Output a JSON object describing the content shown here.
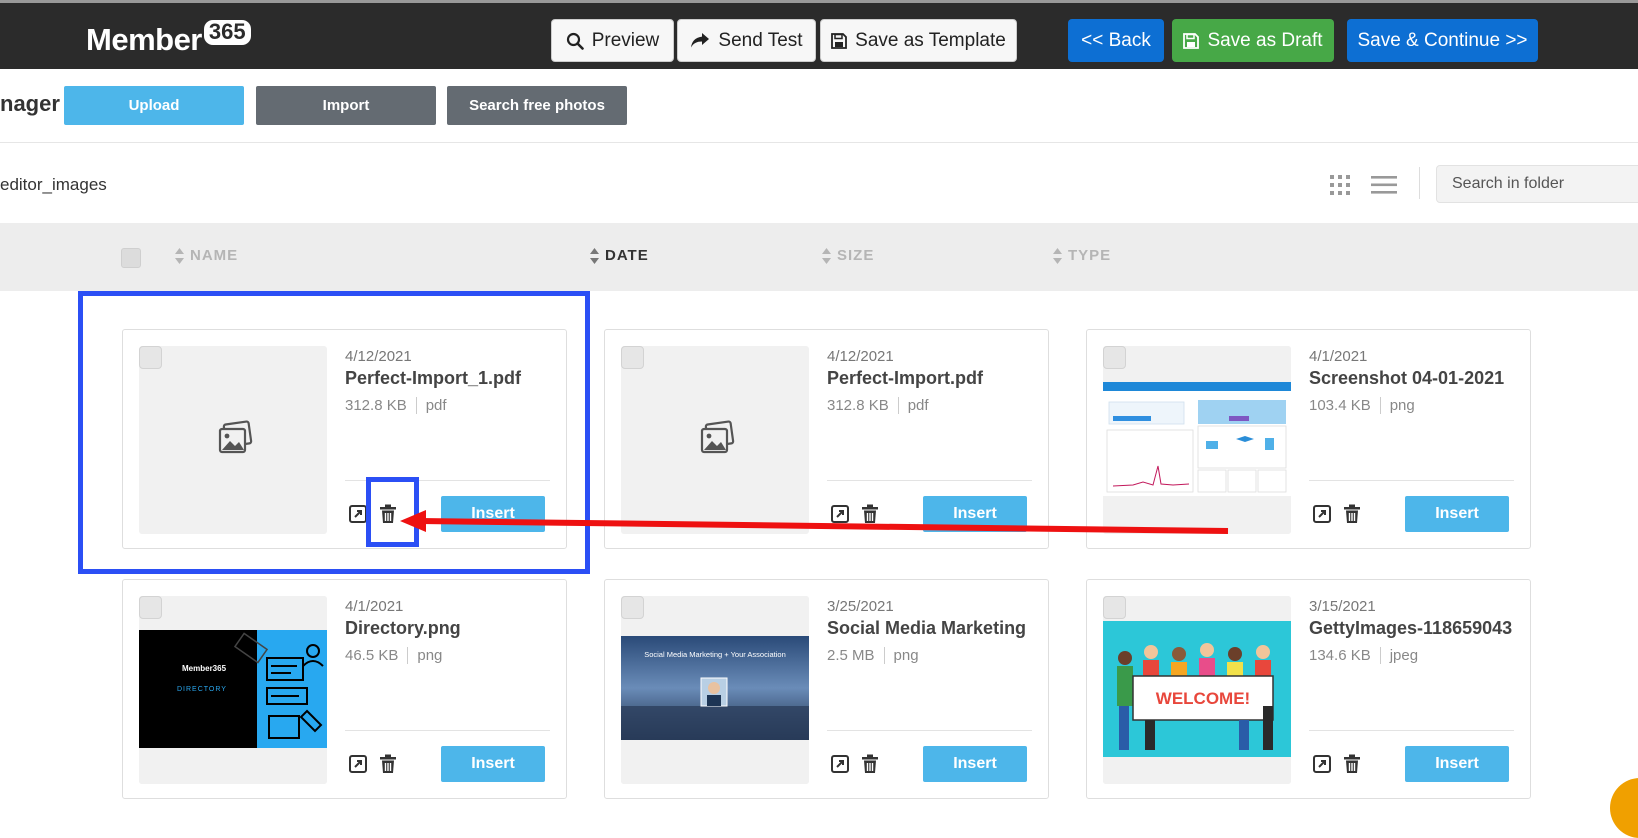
{
  "header": {
    "logo": {
      "word": "Member",
      "badge": "365"
    },
    "buttons": {
      "preview": "Preview",
      "send_test": "Send Test",
      "save_template": "Save as Template",
      "back": "<< Back",
      "save_draft": "Save as Draft",
      "save_continue": "Save & Continue >>"
    }
  },
  "manager": {
    "title": "nager",
    "upload": "Upload",
    "import": "Import",
    "search_photos": "Search free photos"
  },
  "folder": {
    "path": "editor_images",
    "search_placeholder": "Search in folder"
  },
  "columns": {
    "name": "NAME",
    "date": "DATE",
    "size": "SIZE",
    "type": "TYPE"
  },
  "insert_label": "Insert",
  "files": [
    {
      "date": "4/12/2021",
      "name": "Perfect-Import_1.pdf",
      "size": "312.8 KB",
      "type": "pdf",
      "thumb": "placeholder"
    },
    {
      "date": "4/12/2021",
      "name": "Perfect-Import.pdf",
      "size": "312.8 KB",
      "type": "pdf",
      "thumb": "placeholder"
    },
    {
      "date": "4/1/2021",
      "name": "Screenshot 04-01-2021",
      "size": "103.4 KB",
      "type": "png",
      "thumb": "screenshot"
    },
    {
      "date": "4/1/2021",
      "name": "Directory.png",
      "size": "46.5 KB",
      "type": "png",
      "thumb": "directory"
    },
    {
      "date": "3/25/2021",
      "name": "Social Media Marketing",
      "size": "2.5 MB",
      "type": "png",
      "thumb": "social"
    },
    {
      "date": "3/15/2021",
      "name": "GettyImages-118659043",
      "size": "134.6 KB",
      "type": "jpeg",
      "thumb": "welcome"
    }
  ],
  "thumb_text": {
    "directory_brand": "Member365",
    "directory_title": "DIRECTORY",
    "social_title": "Social Media Marketing + Your Association",
    "welcome": "WELCOME!"
  },
  "annotation_color": "#2b4ff5",
  "arrow_color": "#ee1111"
}
